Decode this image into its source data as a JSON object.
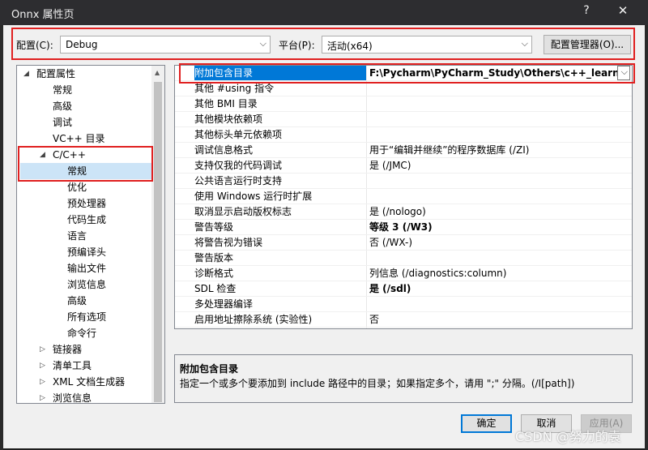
{
  "window": {
    "title": "Onnx 属性页",
    "help": "?",
    "close": "✕"
  },
  "toolbar": {
    "config_label": "配置(C):",
    "config_value": "Debug",
    "platform_label": "平台(P):",
    "platform_value": "活动(x64)",
    "config_manager": "配置管理器(O)..."
  },
  "tree": [
    {
      "label": "配置属性",
      "level": 0,
      "expander": "◢"
    },
    {
      "label": "常规",
      "level": 1
    },
    {
      "label": "高级",
      "level": 1
    },
    {
      "label": "调试",
      "level": 1
    },
    {
      "label": "VC++ 目录",
      "level": 1
    },
    {
      "label": "C/C++",
      "level": 1,
      "expander": "◢"
    },
    {
      "label": "常规",
      "level": 2,
      "selected": true
    },
    {
      "label": "优化",
      "level": 2
    },
    {
      "label": "预处理器",
      "level": 2
    },
    {
      "label": "代码生成",
      "level": 2
    },
    {
      "label": "语言",
      "level": 2
    },
    {
      "label": "预编译头",
      "level": 2
    },
    {
      "label": "输出文件",
      "level": 2
    },
    {
      "label": "浏览信息",
      "level": 2
    },
    {
      "label": "高级",
      "level": 2
    },
    {
      "label": "所有选项",
      "level": 2
    },
    {
      "label": "命令行",
      "level": 2
    },
    {
      "label": "链接器",
      "level": 1,
      "expander": "▷"
    },
    {
      "label": "清单工具",
      "level": 1,
      "expander": "▷"
    },
    {
      "label": "XML 文档生成器",
      "level": 1,
      "expander": "▷"
    },
    {
      "label": "浏览信息",
      "level": 1,
      "expander": "▷"
    }
  ],
  "properties": [
    {
      "name": "附加包含目录",
      "value": "F:\\Pycharm\\PyCharm_Study\\Others\\c++_learning\\",
      "highlight": true
    },
    {
      "name": "其他 #using 指令",
      "value": ""
    },
    {
      "name": "其他 BMI 目录",
      "value": ""
    },
    {
      "name": "其他模块依赖项",
      "value": ""
    },
    {
      "name": "其他标头单元依赖项",
      "value": ""
    },
    {
      "name": "调试信息格式",
      "value": "用于“编辑并继续”的程序数据库 (/ZI)"
    },
    {
      "name": "支持仅我的代码调试",
      "value": "是 (/JMC)"
    },
    {
      "name": "公共语言运行时支持",
      "value": ""
    },
    {
      "name": "使用 Windows 运行时扩展",
      "value": ""
    },
    {
      "name": "取消显示启动版权标志",
      "value": "是 (/nologo)"
    },
    {
      "name": "警告等级",
      "value": "等级 3 (/W3)",
      "bold": true
    },
    {
      "name": "将警告视为错误",
      "value": "否 (/WX-)"
    },
    {
      "name": "警告版本",
      "value": ""
    },
    {
      "name": "诊断格式",
      "value": "列信息 (/diagnostics:column)"
    },
    {
      "name": "SDL 检查",
      "value": "是 (/sdl)",
      "bold": true
    },
    {
      "name": "多处理器编译",
      "value": ""
    },
    {
      "name": "启用地址擦除系统 (实验性)",
      "value": "否"
    }
  ],
  "description": {
    "title": "附加包含目录",
    "text": "指定一个或多个要添加到 include 路径中的目录；如果指定多个，请用 \";\" 分隔。(/I[path])"
  },
  "buttons": {
    "ok": "确定",
    "cancel": "取消",
    "apply": "应用(A)"
  },
  "watermark": "CSDN @努力的袁",
  "colors": {
    "selection": "#0078d7",
    "annotation": "#e02020",
    "titlebar": "#2d2d30"
  }
}
